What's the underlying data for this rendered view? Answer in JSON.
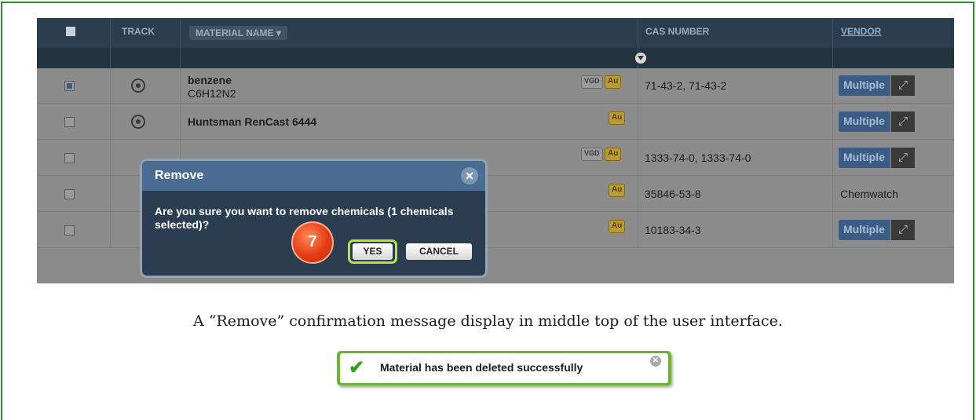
{
  "table": {
    "columns": {
      "track": "TRACK",
      "material_name": "MATERIAL NAME",
      "material_sort_glyph": "▾",
      "cas_number": "CAS NUMBER",
      "vendor": "VENDOR"
    },
    "rows": [
      {
        "checked": true,
        "name": "benzene",
        "formula": "C6H12N2",
        "tags": [
          "VGD",
          "Au"
        ],
        "cas": "71-43-2, 71-43-2",
        "vendor": "Multiple"
      },
      {
        "checked": false,
        "name": "Huntsman RenCast 6444",
        "formula": "",
        "tags": [
          "Au"
        ],
        "cas": "",
        "vendor": "Multiple"
      },
      {
        "checked": false,
        "name": "",
        "formula": "",
        "tags": [
          "VGD",
          "Au"
        ],
        "cas": "1333-74-0, 1333-74-0",
        "vendor": "Multiple"
      },
      {
        "checked": false,
        "name": "",
        "formula": "",
        "tags": [
          "Au"
        ],
        "cas": "35846-53-8",
        "vendor": "Chemwatch"
      },
      {
        "checked": false,
        "name": "",
        "formula": "",
        "tags": [
          "Au"
        ],
        "cas": "10183-34-3",
        "vendor": "Multiple"
      }
    ],
    "expand_glyph": "⤢"
  },
  "dialog": {
    "title": "Remove",
    "close_glyph": "✕",
    "message": "Are you sure you want to remove chemicals (1 chemicals selected)?",
    "yes_label": "YES",
    "cancel_label": "CANCEL",
    "step_badge": "7"
  },
  "caption": "A “Remove” confirmation message display in middle top of the user interface.",
  "toast": {
    "icon": "✔",
    "message": "Material has been deleted successfully",
    "close_glyph": "✕"
  },
  "colors": {
    "frame_border": "#2e8b2e",
    "header_bg": "#2c3d50",
    "dialog_bg": "#2b3e51",
    "dialog_title_bg": "#4a6c92",
    "highlight_ring": "#b7e33a",
    "badge": "#e53b15",
    "toast_border": "#6ab42e",
    "multiple_button": "#3b5d85"
  }
}
